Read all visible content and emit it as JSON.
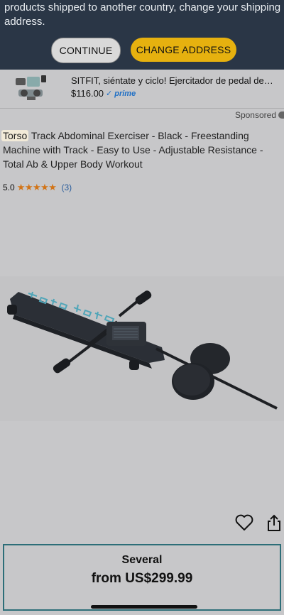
{
  "banner": {
    "message": "products shipped to another country, change your shipping address.",
    "continue_label": "CONTINUE",
    "change_address_label": "CHANGE ADDRESS"
  },
  "strip": {
    "title": "SITFIT, siéntate y ciclo! Ejercitador de pedal de pie…",
    "price": "$116.00",
    "prime": "prime"
  },
  "listing": {
    "sponsored": "Sponsored",
    "title_highlight": "Torso",
    "title_rest": " Track Abdominal Exerciser - Black - Freestanding Machine with Track - Easy to Use - Adjustable Resistance - Total Ab & Upper Body Workout",
    "rating_value": "5.0",
    "stars": "★★★★★",
    "review_count": "(3)"
  },
  "price_box": {
    "several": "Several",
    "from": "from US$299.99"
  },
  "colors": {
    "banner_bg": "#2a3646",
    "change_address_bg": "#e6b10f",
    "price_border": "#2d6e78",
    "star": "#d27417",
    "prime": "#1f6fc5"
  }
}
